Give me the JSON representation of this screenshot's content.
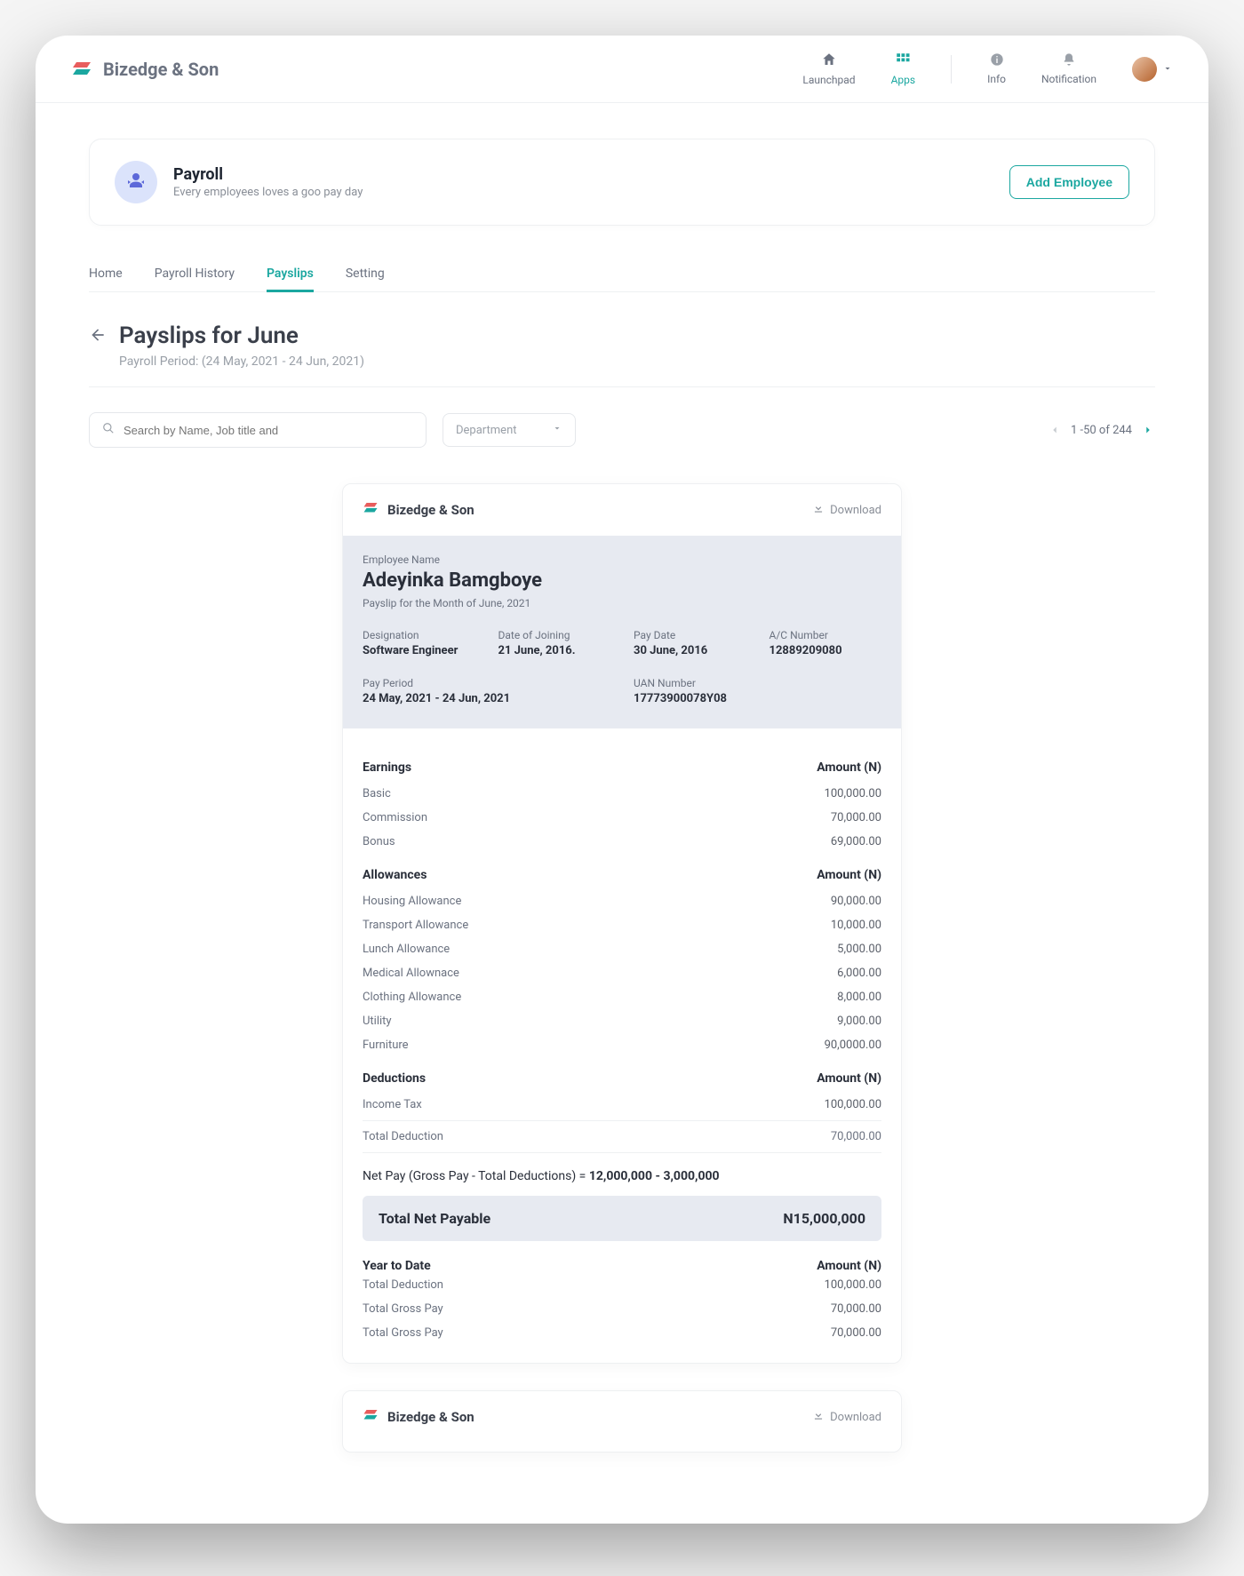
{
  "brand": {
    "name": "Bizedge & Son"
  },
  "top_nav": {
    "launchpad": "Launchpad",
    "apps": "Apps",
    "info": "Info",
    "notification": "Notification"
  },
  "module": {
    "title": "Payroll",
    "subtitle": "Every employees loves a goo pay day",
    "add_button": "Add Employee"
  },
  "tabs": {
    "home": "Home",
    "history": "Payroll History",
    "payslips": "Payslips",
    "setting": "Setting"
  },
  "page": {
    "title": "Payslips for June",
    "period_label": "Payroll Period:",
    "period_value": "(24 May, 2021 - 24 Jun, 2021)"
  },
  "filters": {
    "search_placeholder": "Search by Name, Job title and",
    "department": "Department"
  },
  "pager": {
    "text": "1 -50 of 244"
  },
  "slip": {
    "brand": "Bizedge & Son",
    "download": "Download",
    "emp_label": "Employee Name",
    "emp_name": "Adeyinka Bamgboye",
    "month_text": "Payslip for the Month of June, 2021",
    "info": {
      "designation_k": "Designation",
      "designation_v": "Software Engineer",
      "doj_k": "Date of Joining",
      "doj_v": "21 June, 2016.",
      "pay_date_k": "Pay Date",
      "pay_date_v": "30 June, 2016",
      "ac_k": "A/C Number",
      "ac_v": "12889209080",
      "pay_period_k": "Pay Period",
      "pay_period_v": "24 May, 2021 - 24 Jun, 2021",
      "uan_k": "UAN Number",
      "uan_v": "17773900078Y08"
    },
    "sections": {
      "earnings_h": "Earnings",
      "amount_h": "Amount (N)",
      "basic_k": "Basic",
      "basic_v": "100,000.00",
      "comm_k": "Commission",
      "comm_v": "70,000.00",
      "bonus_k": "Bonus",
      "bonus_v": "69,000.00",
      "allow_h": "Allowances",
      "housing_k": "Housing Allowance",
      "housing_v": "90,000.00",
      "transport_k": "Transport Allowance",
      "transport_v": "10,000.00",
      "lunch_k": "Lunch Allowance",
      "lunch_v": "5,000.00",
      "medical_k": "Medical Allownace",
      "medical_v": "6,000.00",
      "clothing_k": "Clothing Allowance",
      "clothing_v": "8,000.00",
      "utility_k": "Utility",
      "utility_v": "9,000.00",
      "furniture_k": "Furniture",
      "furniture_v": "90,0000.00",
      "deduct_h": "Deductions",
      "tax_k": "Income Tax",
      "tax_v": "100,000.00",
      "totded_k": "Total Deduction",
      "totded_v": "70,000.00",
      "netpay_label": "Net Pay (Gross Pay - Total Deductions) = ",
      "netpay_value": "12,000,000 - 3,000,000",
      "netbox_label": "Total Net Payable",
      "netbox_value": "N15,000,000",
      "ytd_h": "Year to Date",
      "ytd_amt_h": "Amount (N)",
      "ytd_ded_k": "Total Deduction",
      "ytd_ded_v": "100,000.00",
      "ytd_g1_k": "Total Gross Pay",
      "ytd_g1_v": "70,000.00",
      "ytd_g2_k": "Total Gross Pay",
      "ytd_g2_v": "70,000.00"
    }
  },
  "slip2": {
    "brand": "Bizedge & Son",
    "download": "Download"
  }
}
